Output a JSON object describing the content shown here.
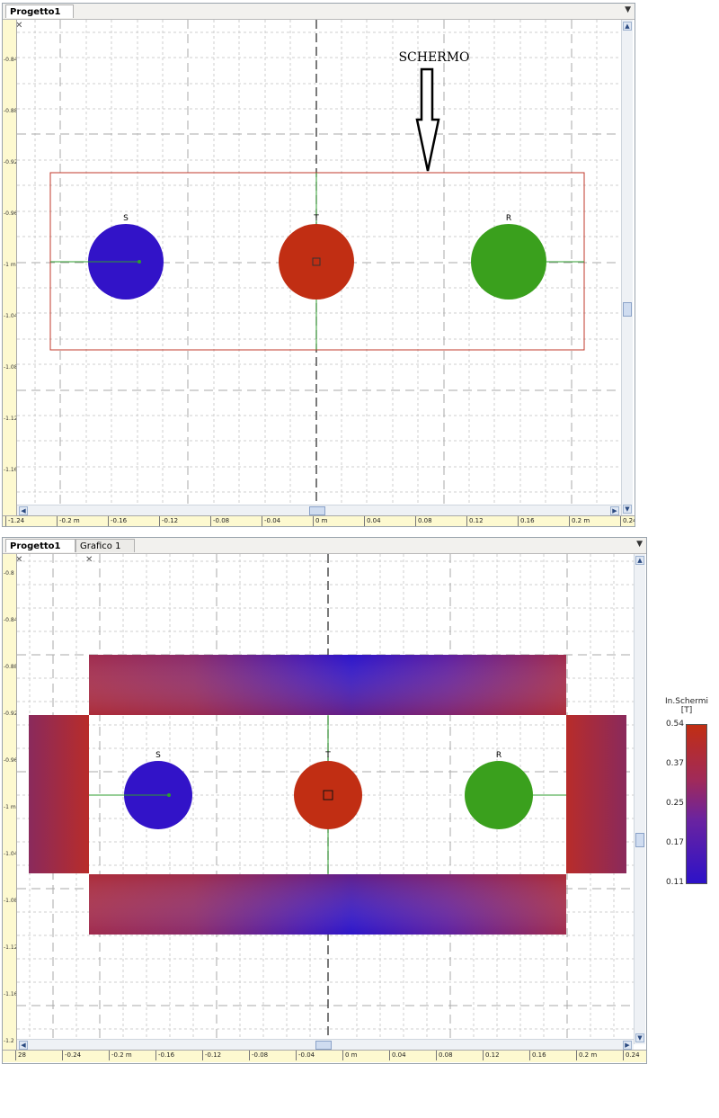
{
  "top_panel": {
    "tabs": [
      {
        "label": "Progetto1",
        "active": true
      }
    ],
    "annotation": "SCHERMO",
    "y_ticks": [
      "-0.84",
      "-0.88",
      "-0.92",
      "-0.96",
      "-1 m",
      "-1.04",
      "-1.08",
      "-1.12",
      "-1.16"
    ],
    "x_ticks": [
      "-1.24",
      "-0.2 m",
      "-0.16",
      "-0.12",
      "-0.08",
      "-0.04",
      "0 m",
      "0.04",
      "0.08",
      "0.12",
      "0.16",
      "0.2 m",
      "0.24"
    ],
    "conductors": [
      {
        "label": "S",
        "color": "#3213c8"
      },
      {
        "label": "T",
        "color": "#c12e13"
      },
      {
        "label": "R",
        "color": "#3aa01d"
      }
    ]
  },
  "bottom_panel": {
    "tabs": [
      {
        "label": "Progetto1",
        "active": true
      },
      {
        "label": "Grafico 1",
        "active": false
      }
    ],
    "y_ticks": [
      "-0.8",
      "-0.84",
      "-0.88",
      "-0.92",
      "-0.96",
      "-1 m",
      "-1.04",
      "-1.08",
      "-1.12",
      "-1.16",
      "-1.2"
    ],
    "x_ticks": [
      "28",
      "-0.24",
      "-0.2 m",
      "-0.16",
      "-0.12",
      "-0.08",
      "-0.04",
      "0 m",
      "0.04",
      "0.08",
      "0.12",
      "0.16",
      "0.2 m",
      "0.24"
    ],
    "conductors": [
      {
        "label": "S",
        "color": "#3213c8"
      },
      {
        "label": "T",
        "color": "#c12e13"
      },
      {
        "label": "R",
        "color": "#3aa01d"
      }
    ]
  },
  "legend": {
    "title_line1": "In.Schermi",
    "title_line2": "[T]",
    "values": [
      "0.54",
      "0.37",
      "0.25",
      "0.17",
      "0.11"
    ],
    "color_high": "#c12e13",
    "color_low": "#2d12c8"
  }
}
